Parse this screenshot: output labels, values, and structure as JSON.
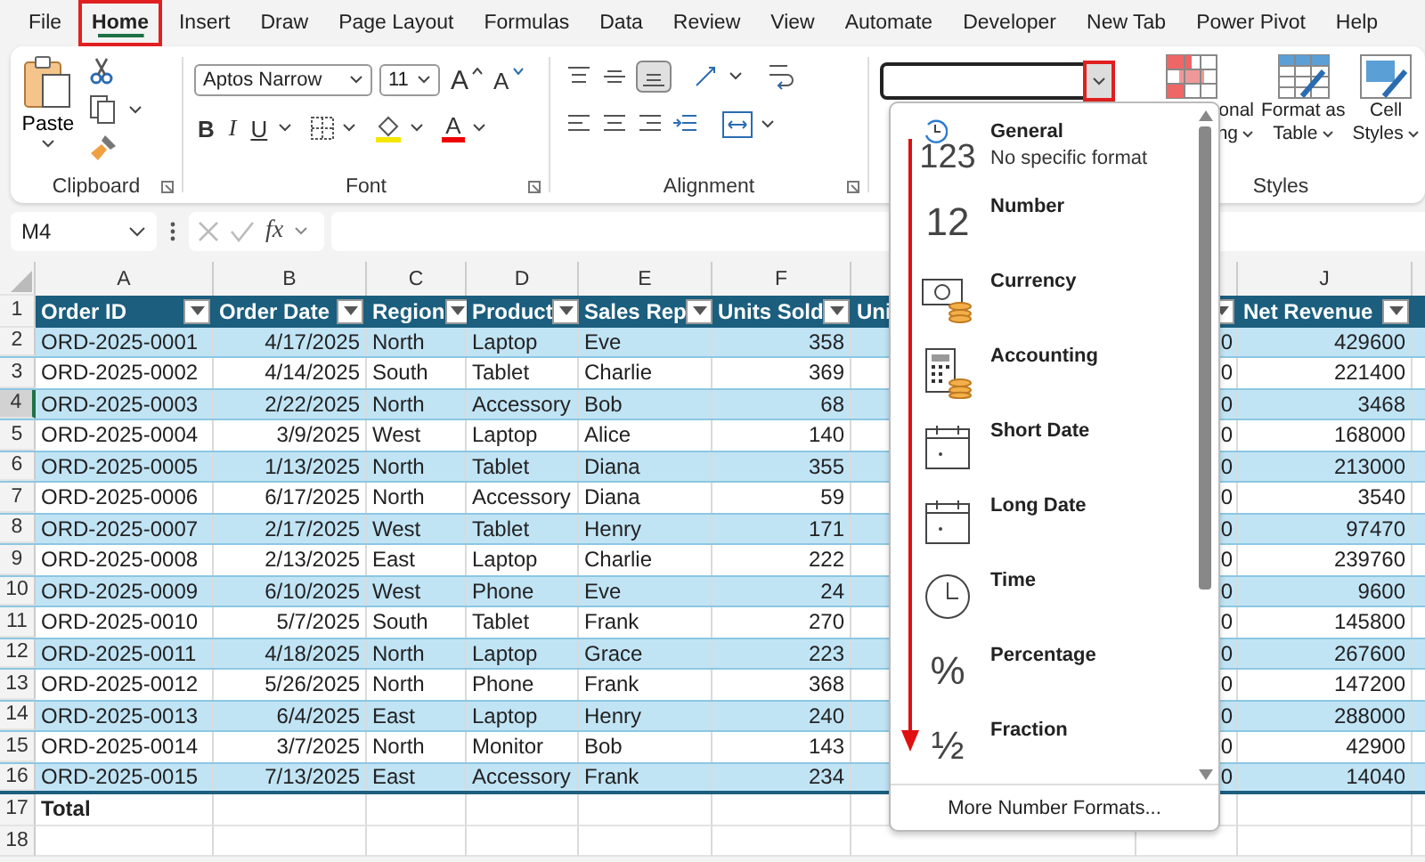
{
  "menu_tabs": [
    {
      "label": "File",
      "selected": false,
      "highlighted": false
    },
    {
      "label": "Home",
      "selected": true,
      "highlighted": true
    },
    {
      "label": "Insert",
      "selected": false,
      "highlighted": false
    },
    {
      "label": "Draw",
      "selected": false,
      "highlighted": false
    },
    {
      "label": "Page Layout",
      "selected": false,
      "highlighted": false
    },
    {
      "label": "Formulas",
      "selected": false,
      "highlighted": false
    },
    {
      "label": "Data",
      "selected": false,
      "highlighted": false
    },
    {
      "label": "Review",
      "selected": false,
      "highlighted": false
    },
    {
      "label": "View",
      "selected": false,
      "highlighted": false
    },
    {
      "label": "Automate",
      "selected": false,
      "highlighted": false
    },
    {
      "label": "Developer",
      "selected": false,
      "highlighted": false
    },
    {
      "label": "New Tab",
      "selected": false,
      "highlighted": false
    },
    {
      "label": "Power Pivot",
      "selected": false,
      "highlighted": false
    },
    {
      "label": "Help",
      "selected": false,
      "highlighted": false
    }
  ],
  "ribbon": {
    "clipboard": {
      "paste": "Paste",
      "label": "Clipboard"
    },
    "font": {
      "name": "Aptos Narrow",
      "size": "11",
      "grow": "A",
      "shrink": "A",
      "bold": "B",
      "italic": "I",
      "underline": "U",
      "color_letter": "A",
      "label": "Font"
    },
    "alignment": {
      "label": "Alignment"
    },
    "number_format": {
      "dropdown_highlighted": true
    },
    "styles": {
      "conditional": [
        "onal",
        "ng"
      ],
      "format_as_table": [
        "Format as",
        "Table"
      ],
      "cell_styles": [
        "Cell",
        "Styles"
      ],
      "label": "Styles"
    }
  },
  "formula_bar": {
    "name_box": "M4",
    "function_label": "fx"
  },
  "sheet": {
    "columns": [
      {
        "letter": "A",
        "header": "Order ID",
        "numeric": false,
        "filter": true
      },
      {
        "letter": "B",
        "header": "Order Date",
        "numeric": true,
        "filter": true
      },
      {
        "letter": "C",
        "header": "Region",
        "numeric": false,
        "filter": true
      },
      {
        "letter": "D",
        "header": "Product",
        "numeric": false,
        "filter": true
      },
      {
        "letter": "E",
        "header": "Sales Rep",
        "numeric": false,
        "filter": true
      },
      {
        "letter": "F",
        "header": "Units Sold",
        "numeric": true,
        "filter": true
      },
      {
        "numeric": true,
        "filter": true
      },
      {
        "letter": "J",
        "header": "Net Revenue",
        "numeric": true,
        "filter": true
      }
    ],
    "cut_header": "Uni",
    "row_headers": [
      {
        "label": "1",
        "selected": false
      },
      {
        "label": "2",
        "selected": false
      },
      {
        "label": "3",
        "selected": false
      },
      {
        "label": "4",
        "selected": true
      },
      {
        "label": "5",
        "selected": false
      },
      {
        "label": "6",
        "selected": false
      },
      {
        "label": "7",
        "selected": false
      },
      {
        "label": "8",
        "selected": false
      },
      {
        "label": "9",
        "selected": false
      },
      {
        "label": "10",
        "selected": false
      },
      {
        "label": "11",
        "selected": false
      },
      {
        "label": "12",
        "selected": false
      },
      {
        "label": "13",
        "selected": false
      },
      {
        "label": "14",
        "selected": false
      },
      {
        "label": "15",
        "selected": false
      },
      {
        "label": "16",
        "selected": false
      },
      {
        "label": "17",
        "selected": false
      },
      {
        "label": "18",
        "selected": false
      }
    ],
    "rows": [
      [
        "ORD-2025-0001",
        "4/17/2025",
        "North",
        "Laptop",
        "Eve",
        "358",
        "0",
        "429600"
      ],
      [
        "ORD-2025-0002",
        "4/14/2025",
        "South",
        "Tablet",
        "Charlie",
        "369",
        "0",
        "221400"
      ],
      [
        "ORD-2025-0003",
        "2/22/2025",
        "North",
        "Accessory",
        "Bob",
        "68",
        "0",
        "3468"
      ],
      [
        "ORD-2025-0004",
        "3/9/2025",
        "West",
        "Laptop",
        "Alice",
        "140",
        "0",
        "168000"
      ],
      [
        "ORD-2025-0005",
        "1/13/2025",
        "North",
        "Tablet",
        "Diana",
        "355",
        "0",
        "213000"
      ],
      [
        "ORD-2025-0006",
        "6/17/2025",
        "North",
        "Accessory",
        "Diana",
        "59",
        "0",
        "3540"
      ],
      [
        "ORD-2025-0007",
        "2/17/2025",
        "West",
        "Tablet",
        "Henry",
        "171",
        "0",
        "97470"
      ],
      [
        "ORD-2025-0008",
        "2/13/2025",
        "East",
        "Laptop",
        "Charlie",
        "222",
        "0",
        "239760"
      ],
      [
        "ORD-2025-0009",
        "6/10/2025",
        "West",
        "Phone",
        "Eve",
        "24",
        "0",
        "9600"
      ],
      [
        "ORD-2025-0010",
        "5/7/2025",
        "South",
        "Tablet",
        "Frank",
        "270",
        "0",
        "145800"
      ],
      [
        "ORD-2025-0011",
        "4/18/2025",
        "North",
        "Laptop",
        "Grace",
        "223",
        "0",
        "267600"
      ],
      [
        "ORD-2025-0012",
        "5/26/2025",
        "North",
        "Phone",
        "Frank",
        "368",
        "0",
        "147200"
      ],
      [
        "ORD-2025-0013",
        "6/4/2025",
        "East",
        "Laptop",
        "Henry",
        "240",
        "0",
        "288000"
      ],
      [
        "ORD-2025-0014",
        "3/7/2025",
        "North",
        "Monitor",
        "Bob",
        "143",
        "0",
        "42900"
      ],
      [
        "ORD-2025-0015",
        "7/13/2025",
        "East",
        "Accessory",
        "Frank",
        "234",
        "0",
        "14040"
      ]
    ],
    "total_label": "Total"
  },
  "format_menu": {
    "scroll_arrow": true,
    "items": [
      {
        "kind": "general",
        "label": "General",
        "sub": "No specific format",
        "glyph": "123"
      },
      {
        "kind": "number",
        "label": "Number",
        "glyph": "12"
      },
      {
        "kind": "currency",
        "label": "Currency"
      },
      {
        "kind": "accounting",
        "label": "Accounting"
      },
      {
        "kind": "short_date",
        "label": "Short Date"
      },
      {
        "kind": "long_date",
        "label": "Long Date"
      },
      {
        "kind": "time",
        "label": "Time"
      },
      {
        "kind": "percentage",
        "label": "Percentage",
        "glyph": "%"
      },
      {
        "kind": "fraction",
        "label": "Fraction",
        "glyph": "½"
      }
    ],
    "more": "More Number Formats..."
  }
}
